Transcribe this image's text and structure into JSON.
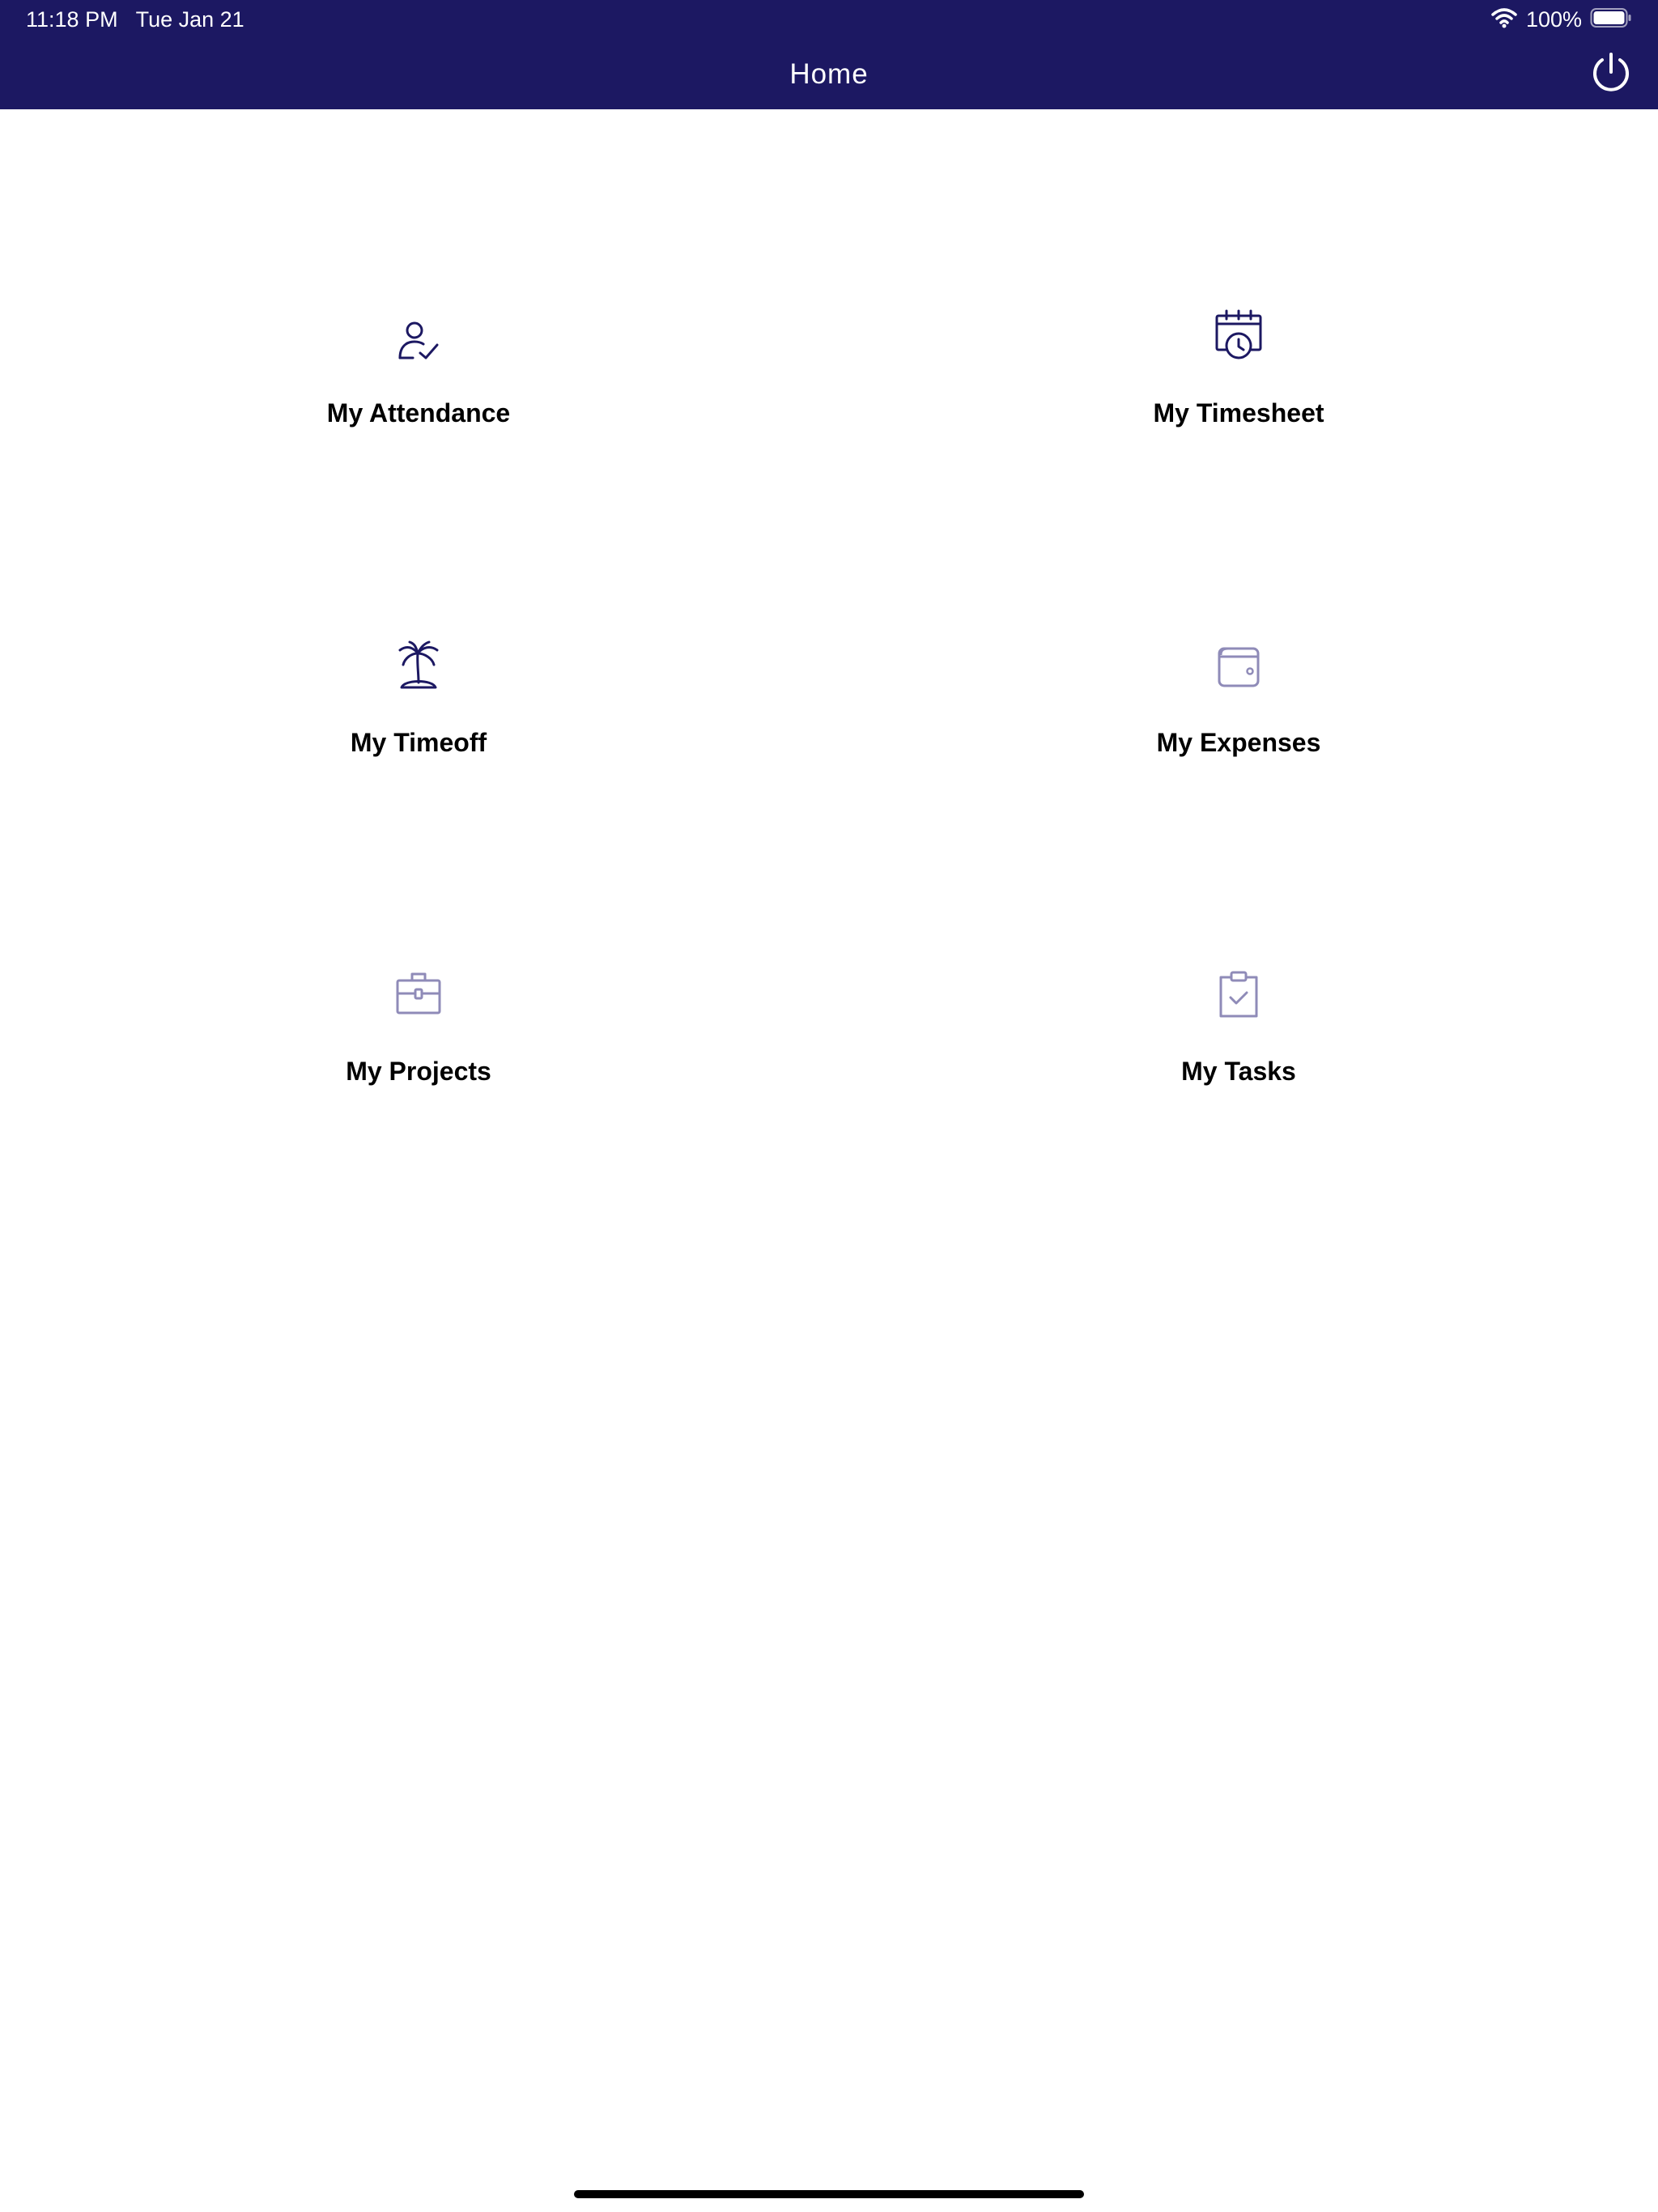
{
  "status_bar": {
    "time_date": "11:18 PM   Tue Jan 21",
    "battery_percent": "100%",
    "wifi_icon": "wifi-icon",
    "battery_icon": "battery-icon"
  },
  "nav": {
    "title": "Home",
    "power_icon": "power-icon"
  },
  "colors": {
    "nav_background": "#1c1862",
    "icon_active": "#1c1862",
    "icon_muted": "#8f8bb8",
    "label": "#000000"
  },
  "tiles": [
    {
      "label": "My Attendance",
      "icon": "attendance-icon"
    },
    {
      "label": "My Timesheet",
      "icon": "timesheet-icon"
    },
    {
      "label": "My Timeoff",
      "icon": "timeoff-icon"
    },
    {
      "label": "My Expenses",
      "icon": "expenses-icon"
    },
    {
      "label": "My Projects",
      "icon": "projects-icon"
    },
    {
      "label": "My Tasks",
      "icon": "tasks-icon"
    }
  ]
}
